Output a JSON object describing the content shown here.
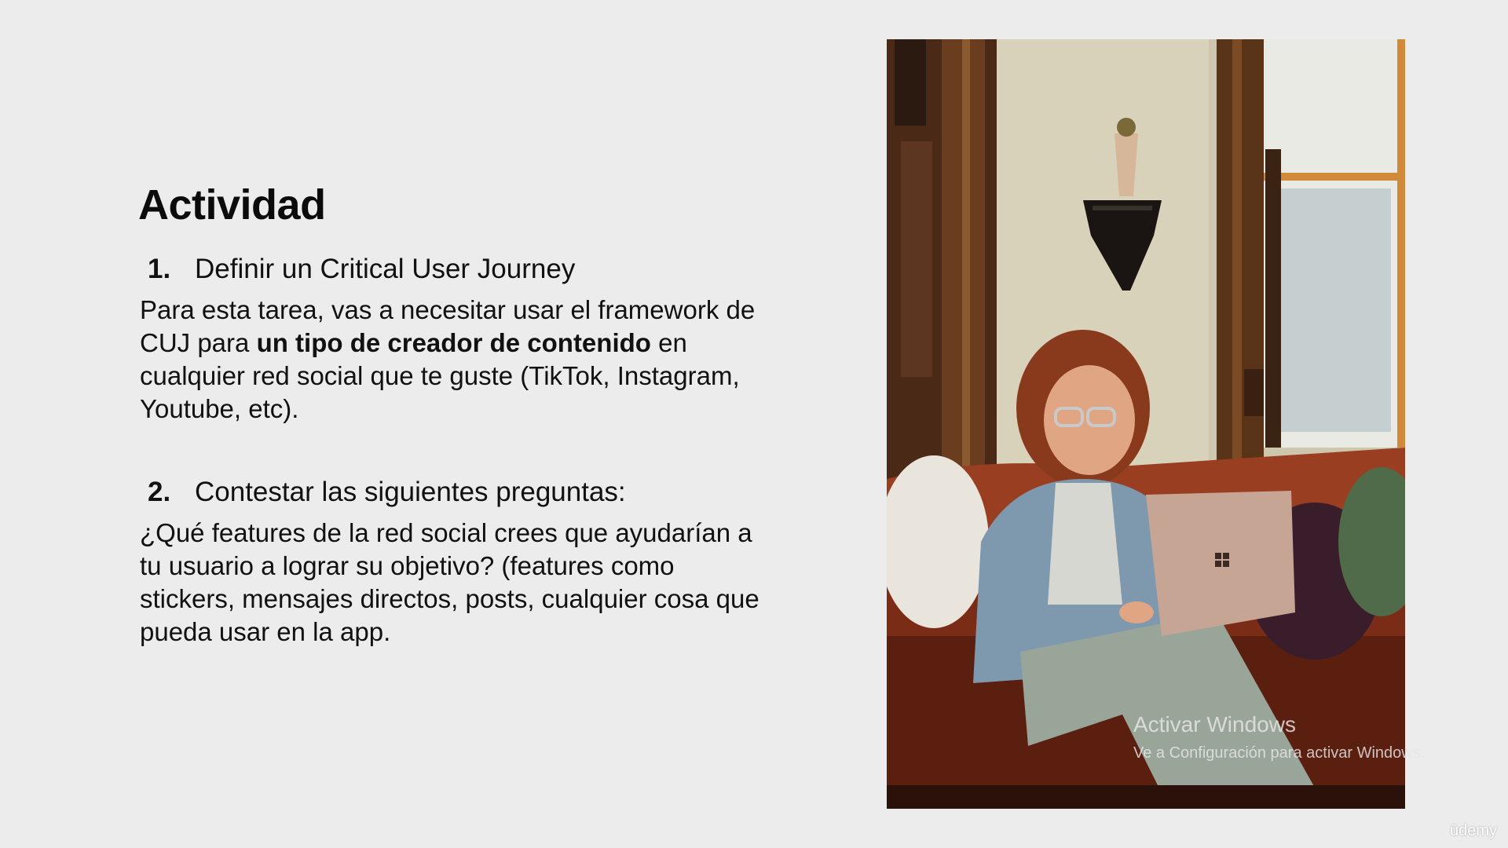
{
  "slide": {
    "title": "Actividad",
    "steps": [
      {
        "number": "1.",
        "heading": "Definir un Critical User Journey",
        "body_before": "Para esta tarea, vas a necesitar usar el framework de CUJ para ",
        "body_bold": "un tipo de creador de contenido",
        "body_after": " en cualquier red social que te guste (TikTok, Instagram, Youtube, etc)."
      },
      {
        "number": "2.",
        "heading": "Contestar las siguientes preguntas:",
        "body": "¿Qué features de la red social crees que ayudarían a tu usuario a lograr su objetivo? (features como stickers, mensajes directos, posts, cualquier cosa que pueda usar en la app."
      }
    ]
  },
  "watermark": {
    "title": "Activar Windows",
    "subtitle": "Ve a Configuración para activar Windows."
  },
  "brand": "ūdemy",
  "colors": {
    "background": "#ececec",
    "text": "#111111"
  }
}
